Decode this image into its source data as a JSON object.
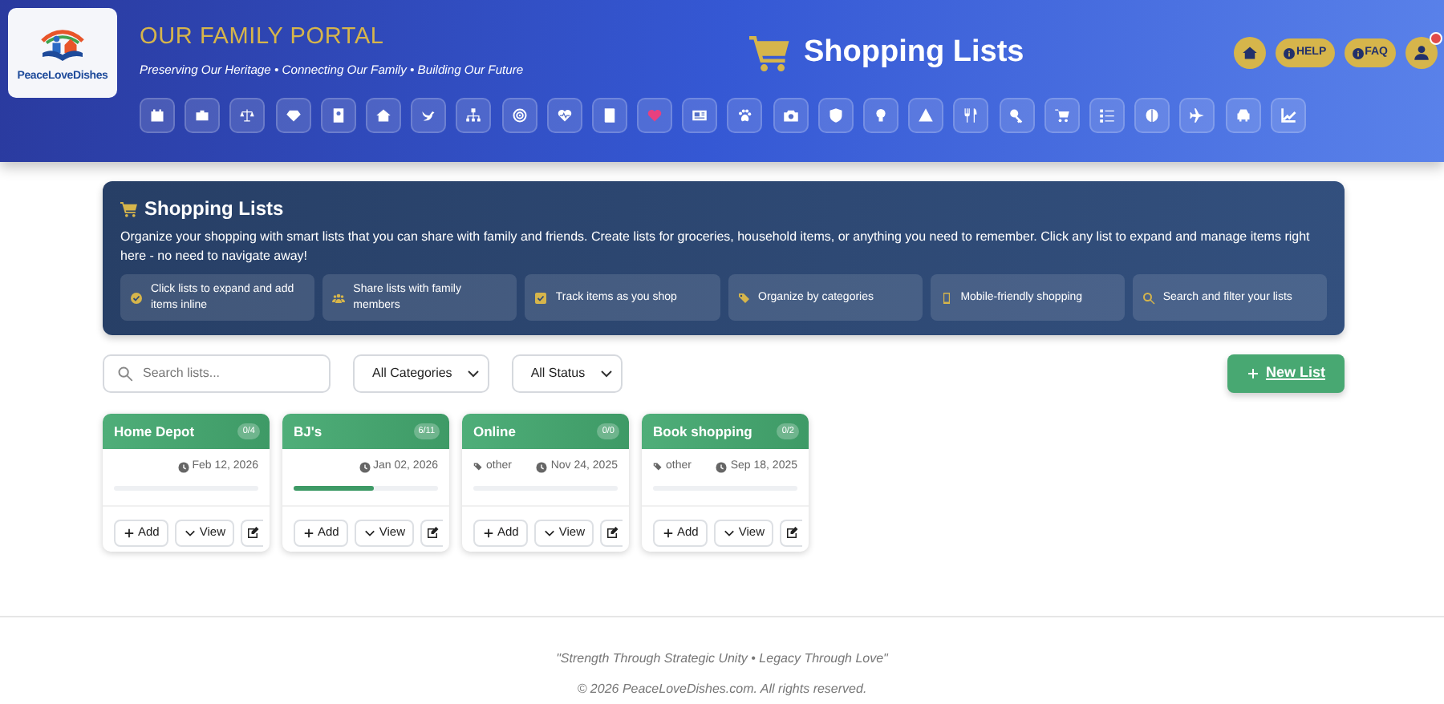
{
  "logo": {
    "text": "PeaceLoveDishes"
  },
  "portal": {
    "title": "OUR FAMILY PORTAL",
    "tagline": "Preserving Our Heritage • Connecting Our Family • Building Our Future"
  },
  "page_title": "Shopping Lists",
  "top_buttons": [
    {
      "kind": "home"
    },
    {
      "kind": "pill",
      "label": "HELP"
    },
    {
      "kind": "pill",
      "label": "FAQ"
    },
    {
      "kind": "user",
      "alert": true
    }
  ],
  "nav_buttons": [
    {
      "color": "#ffffff"
    },
    {
      "color": "#ffffff"
    },
    {
      "color": "#ffffff"
    },
    {
      "color": "#ffffff"
    },
    {
      "color": "#ffffff"
    },
    {
      "color": "#ffffff"
    },
    {
      "color": "#ffffff"
    },
    {
      "color": "#ffffff"
    },
    {
      "color": "#ffffff"
    },
    {
      "color": "#ffffff"
    },
    {
      "color": "#ffffff"
    },
    {
      "color": "#e8407f"
    },
    {
      "color": "#ffffff"
    },
    {
      "color": "#ffffff"
    },
    {
      "color": "#ffffff"
    },
    {
      "color": "#ffffff"
    },
    {
      "color": "#ffffff"
    },
    {
      "color": "#ffffff"
    },
    {
      "color": "#ffffff"
    },
    {
      "color": "#ffffff"
    },
    {
      "color": "#ffffff"
    },
    {
      "color": "#ffffff"
    },
    {
      "color": "#ffffff"
    },
    {
      "color": "#ffffff"
    },
    {
      "color": "#ffffff"
    },
    {
      "color": "#ffffff"
    }
  ],
  "info": {
    "title": "Shopping Lists",
    "text": "Organize your shopping with smart lists that you can share with family and friends. Create lists for groceries, household items, or anything you need to remember. Click any list to expand and manage items right here - no need to navigate away!",
    "features": [
      {
        "kind": "check",
        "text": "Click lists to expand and add items inline"
      },
      {
        "kind": "people",
        "text": "Share lists with family members"
      },
      {
        "kind": "checkbox",
        "text": "Track items as you shop"
      },
      {
        "kind": "tags",
        "text": "Organize by categories"
      },
      {
        "kind": "phone",
        "text": "Mobile-friendly shopping"
      },
      {
        "kind": "search",
        "text": "Search and filter your lists"
      }
    ]
  },
  "toolbar": {
    "search": {
      "placeholder": "Search lists..."
    },
    "filters": [
      "All Categories",
      "All Status"
    ],
    "new_button": "New List"
  },
  "lists": [
    {
      "name": "Home Depot",
      "count": "0/4",
      "date": "Feb 12, 2026",
      "level": 0,
      "buttons": [
        "Add",
        "View"
      ]
    },
    {
      "name": "BJ's",
      "count": "6/11",
      "date": "Jan 02, 2026",
      "level": 0.55,
      "buttons": [
        "Add",
        "View"
      ]
    },
    {
      "name": "Online",
      "count": "0/0",
      "category": "other",
      "date": "Nov 24, 2025",
      "level": 0,
      "buttons": [
        "Add",
        "View"
      ]
    },
    {
      "name": "Book shopping",
      "count": "0/2",
      "category": "other",
      "date": "Sep 18, 2025",
      "level": 0,
      "buttons": [
        "Add",
        "View"
      ]
    }
  ],
  "footer": {
    "quote": "\"Strength Through Strategic Unity • Legacy Through Love\"",
    "copyright": "© 2026 PeaceLoveDishes.com. All rights reserved."
  }
}
